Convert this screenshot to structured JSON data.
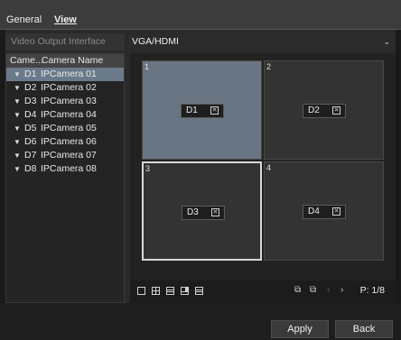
{
  "tabs": [
    {
      "label": "General",
      "active": false
    },
    {
      "label": "View",
      "active": true
    }
  ],
  "video_output": {
    "label": "Video Output Interface",
    "value": "VGA/HDMI"
  },
  "camera_list": {
    "header_col1": "Came...",
    "header_col2": "Camera Name",
    "items": [
      {
        "num": "D1",
        "name": "IPCamera 01",
        "selected": true
      },
      {
        "num": "D2",
        "name": "IPCamera 02"
      },
      {
        "num": "D3",
        "name": "IPCamera 03"
      },
      {
        "num": "D4",
        "name": "IPCamera 04"
      },
      {
        "num": "D5",
        "name": "IPCamera 05"
      },
      {
        "num": "D6",
        "name": "IPCamera 06"
      },
      {
        "num": "D7",
        "name": "IPCamera 07"
      },
      {
        "num": "D8",
        "name": "IPCamera 08"
      }
    ]
  },
  "grid": {
    "cells": [
      {
        "index": "1",
        "channel": "D1",
        "state": "active"
      },
      {
        "index": "2",
        "channel": "D2",
        "state": "normal"
      },
      {
        "index": "3",
        "channel": "D3",
        "state": "outlined"
      },
      {
        "index": "4",
        "channel": "D4",
        "state": "normal"
      }
    ],
    "remove_glyph": "✕"
  },
  "toolbar": {
    "page_label": "P: 1/8",
    "icons": [
      "layout-1-icon",
      "layout-4-icon",
      "layout-6-icon",
      "layout-8-icon",
      "layout-9-icon",
      "swap-icon",
      "copy-icon",
      "prev-page-icon",
      "next-page-icon"
    ]
  },
  "footer": {
    "apply": "Apply",
    "back": "Back"
  },
  "colors": {
    "selected_row": "#6b7a8a",
    "active_cell": "#6a7583",
    "background": "#2a2a2a"
  }
}
